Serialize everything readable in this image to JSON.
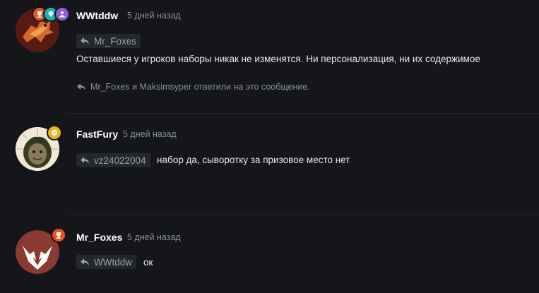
{
  "posts": [
    {
      "author": "WWtddw",
      "time": "5 дней назад",
      "reply_to": "Mr_Foxes",
      "message": "Оставшиеся у игроков наборы никак не изменятся. Ни персонализация, ни их содержимое",
      "replies_text": "Mr_Foxes и Maksimsyper ответили на это сообщение.",
      "badges": [
        "trophy-icon",
        "gem-icon",
        "users-icon"
      ]
    },
    {
      "author": "FastFury",
      "time": "5 дней назад",
      "reply_to": "vz24022004",
      "message": "набор да, сыворотку за призовое место нет",
      "badges": [
        "skull-icon"
      ]
    },
    {
      "author": "Mr_Foxes",
      "time": "5 дней назад",
      "reply_to": "WWtddw",
      "message": "ок",
      "badges": [
        "trophy-icon"
      ]
    }
  ],
  "colors": {
    "background": "#141619",
    "badge_orange": "#e8541e",
    "badge_teal": "#18b5b5",
    "badge_purple": "#8f5bd6",
    "badge_yellow": "#f2b21b",
    "chip_bg": "#24272c",
    "muted_text": "#8a9098"
  }
}
